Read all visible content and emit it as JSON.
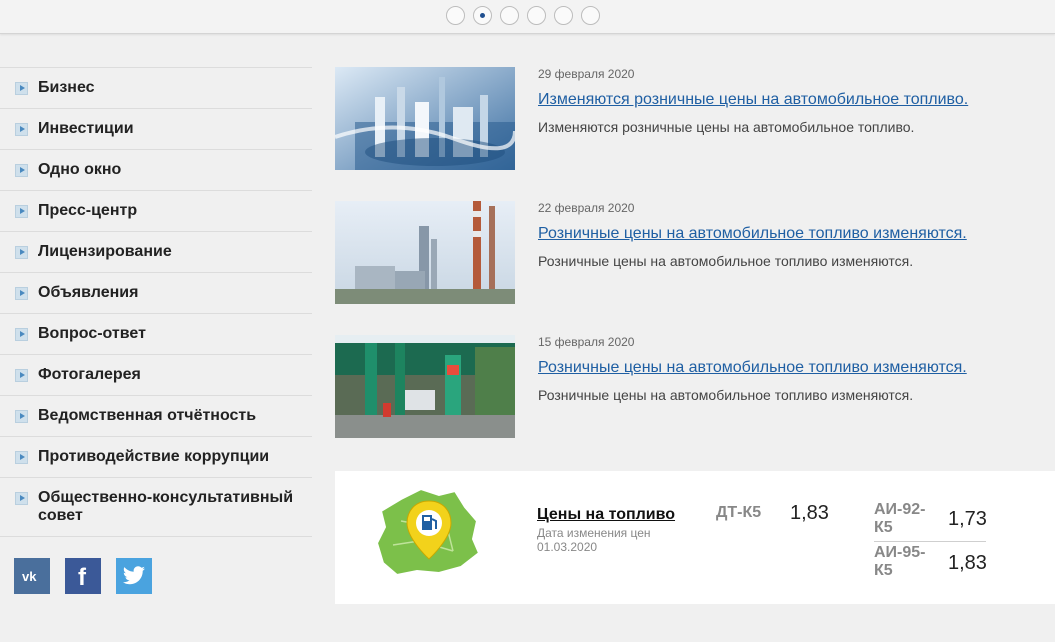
{
  "slider": {
    "count": 6,
    "active_index": 1
  },
  "sidebar": {
    "items": [
      {
        "label": "Бизнес"
      },
      {
        "label": "Инвестиции"
      },
      {
        "label": "Одно окно"
      },
      {
        "label": "Пресс-центр"
      },
      {
        "label": "Лицензирование"
      },
      {
        "label": "Объявления"
      },
      {
        "label": "Вопрос-ответ"
      },
      {
        "label": "Фотогалерея"
      },
      {
        "label": "Ведомственная отчётность"
      },
      {
        "label": "Противодействие коррупции"
      },
      {
        "label": "Общественно-консультативный совет"
      }
    ]
  },
  "social": {
    "vk": "vk-icon",
    "facebook": "facebook-icon",
    "twitter": "twitter-icon"
  },
  "news": [
    {
      "date": "29 февраля 2020",
      "title": "Изменяются розничные цены на автомобильное топливо.",
      "desc": "Изменяются розничные цены на автомобильное топливо."
    },
    {
      "date": "22 февраля 2020",
      "title": "Розничные цены на автомобильное топливо изменяются.",
      "desc": "Розничные цены на автомобильное топливо изменяются."
    },
    {
      "date": "15 февраля 2020",
      "title": "Розничные цены на автомобильное топливо изменяются.",
      "desc": "Розничные цены на автомобильное топливо изменяются."
    }
  ],
  "fuel": {
    "title": "Цены на топливо",
    "date_label": "Дата изменения цен 01.03.2020",
    "dt_name": "ДТ-К5",
    "dt_value": "1,83",
    "ai92_name": "АИ-92-К5",
    "ai92_value": "1,73",
    "ai95_name": "АИ-95-К5",
    "ai95_value": "1,83"
  },
  "colors": {
    "link": "#1f5fa3",
    "accent": "#1f4f8f",
    "background": "#f0f0f0"
  }
}
